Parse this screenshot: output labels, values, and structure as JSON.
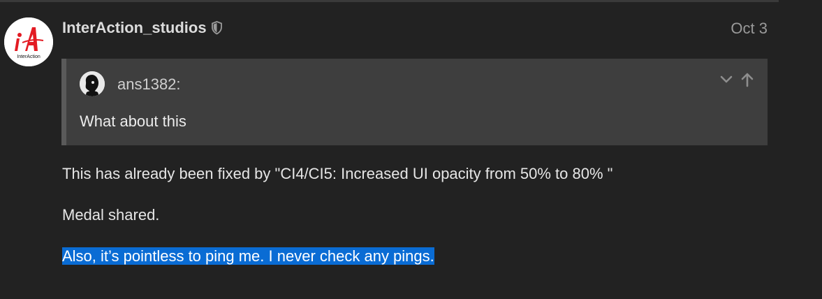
{
  "post": {
    "username": "InterAction_studios",
    "date": "Oct 3",
    "avatar_text": "InterAction",
    "quote": {
      "author": "ans1382:",
      "text": "What about this"
    },
    "paragraphs": [
      "This has already been fixed by \"CI4/CI5: Increased UI opacity from 50% to 80% \"",
      "Medal shared.",
      "Also, it’s pointless to ping me. I never check any pings."
    ]
  },
  "colors": {
    "background": "#222222",
    "quote_background": "#3e3e3e",
    "quote_border": "#5a5a5a",
    "selection": "#0a6cd4",
    "brand_red": "#e31b23"
  },
  "icons": {
    "moderator": "shield-icon",
    "expand": "chevron-down-icon",
    "jump": "arrow-up-icon"
  }
}
